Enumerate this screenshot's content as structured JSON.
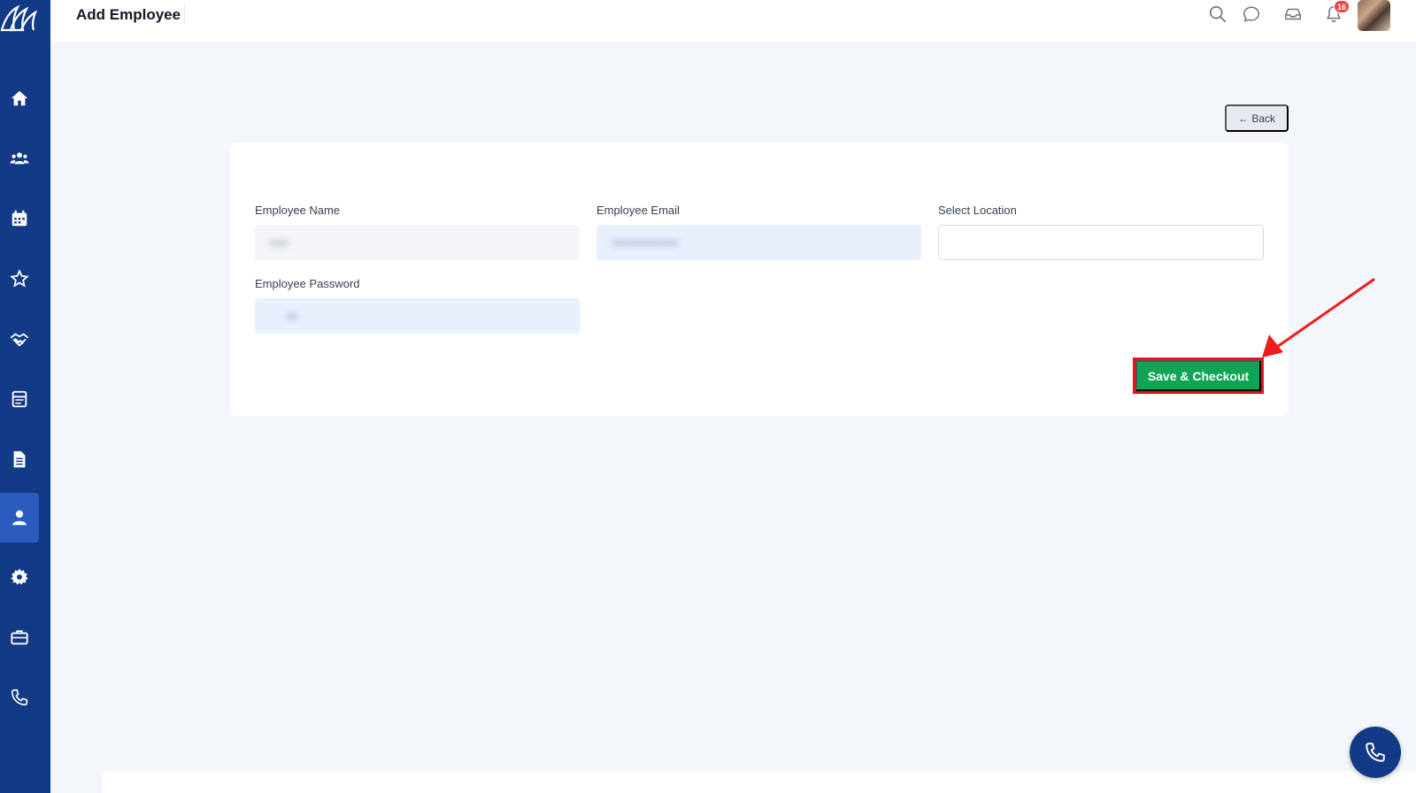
{
  "header": {
    "title": "Add Employee",
    "notification_count": "16"
  },
  "sidebar": {
    "items": [
      {
        "icon": "home-icon",
        "active": false
      },
      {
        "icon": "team-icon",
        "active": false
      },
      {
        "icon": "calendar-icon",
        "active": false
      },
      {
        "icon": "star-icon",
        "active": false
      },
      {
        "icon": "handshake-icon",
        "active": false
      },
      {
        "icon": "form-icon",
        "active": false
      },
      {
        "icon": "document-icon",
        "active": false
      },
      {
        "icon": "user-icon",
        "active": true
      },
      {
        "icon": "gear-icon",
        "active": false
      },
      {
        "icon": "briefcase-icon",
        "active": false
      },
      {
        "icon": "phone-icon",
        "active": false
      }
    ]
  },
  "actions": {
    "back_label": "← Back",
    "save_label": "Save & Checkout"
  },
  "form": {
    "name_label": "Employee Name",
    "name_value": "•••",
    "email_label": "Employee Email",
    "email_value": "•••••••••••",
    "location_label": "Select Location",
    "location_value": "",
    "password_label": "Employee Password",
    "password_value": "••"
  },
  "colors": {
    "sidebar": "#123a86",
    "save_button": "#10a455",
    "highlight": "#e5131b",
    "background": "#f3f6fa"
  }
}
